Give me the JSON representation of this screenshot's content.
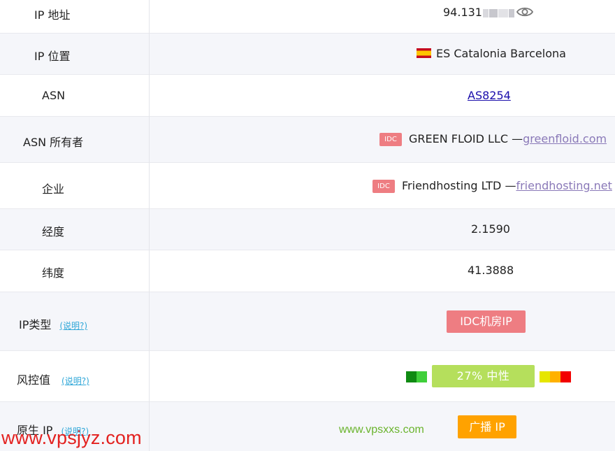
{
  "rows": {
    "ip_address": {
      "label": "IP 地址",
      "value": "94.131"
    },
    "ip_location": {
      "label": "IP 位置",
      "flag": "🇪🇸",
      "value": "ES Catalonia Barcelona"
    },
    "asn": {
      "label": "ASN",
      "value": "AS8254"
    },
    "asn_owner": {
      "label": "ASN 所有者",
      "tag": "IDC",
      "name": "GREEN FLOID LLC —",
      "domain": "greenfloid.com"
    },
    "enterprise": {
      "label": "企业",
      "tag": "IDC",
      "name": "Friendhosting LTD —",
      "domain": "friendhosting.net"
    },
    "longitude": {
      "label": "经度",
      "value": "2.1590"
    },
    "latitude": {
      "label": "纬度",
      "value": "41.3888"
    },
    "ip_type": {
      "label": "IP类型",
      "hint": "(说明?)",
      "value": "IDC机房IP"
    },
    "risk": {
      "label": "风控值",
      "hint": "(说明?)",
      "value": "27%   中性",
      "percent": 27
    },
    "native_ip": {
      "label": "原生 IP",
      "hint": "(说明?)",
      "value": "广播 IP"
    }
  },
  "watermarks": {
    "green": "www.vpsxxs.com",
    "red": "www.vpsjyz.com"
  },
  "colors": {
    "row_alt_bg": "#f5f6fa",
    "idc_red": "#ee7d82",
    "risk_green": "#b5df5c",
    "broadcast_orange": "#ffa200",
    "hint_blue": "#2fa7d8"
  },
  "icons": {
    "reveal": "eye-icon"
  }
}
